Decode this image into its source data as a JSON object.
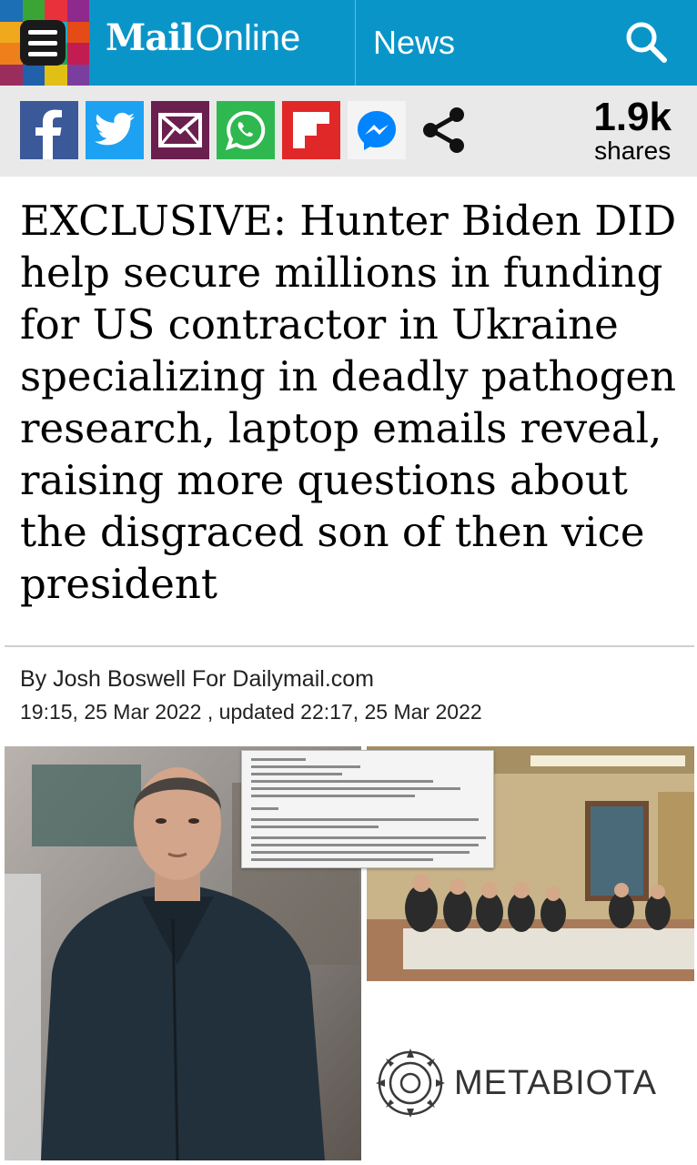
{
  "header": {
    "logo_bold": "Mail",
    "logo_light": "Online",
    "section": "News",
    "icons": [
      "menu-icon",
      "search-icon"
    ]
  },
  "share_bar": {
    "buttons": [
      {
        "name": "facebook",
        "icon": "facebook-icon",
        "color": "#3b5998"
      },
      {
        "name": "twitter",
        "icon": "twitter-icon",
        "color": "#1da1f2"
      },
      {
        "name": "email",
        "icon": "envelope-icon",
        "color": "#6b1f4f"
      },
      {
        "name": "whatsapp",
        "icon": "whatsapp-icon",
        "color": "#2fb84f"
      },
      {
        "name": "flipboard",
        "icon": "flipboard-icon",
        "color": "#e12828"
      },
      {
        "name": "messenger",
        "icon": "messenger-icon",
        "color": "#0084ff"
      },
      {
        "name": "share",
        "icon": "share-icon",
        "color": "#111111"
      }
    ],
    "count": "1.9k",
    "count_label": "shares"
  },
  "article": {
    "headline": "EXCLUSIVE: Hunter Biden DID help secure millions in funding for US contractor in Ukraine specializing in deadly pathogen research, laptop emails reveal, raising more questions about the disgraced son of then vice president",
    "byline": "By Josh Boswell For Dailymail.com",
    "dates": "19:15, 25 Mar 2022 , updated 22:17, 25 Mar 2022",
    "image_logo_text": "METABIOTA"
  },
  "colors": {
    "header_bg": "#0a95c9",
    "sharebar_bg": "#e9e9e9"
  }
}
